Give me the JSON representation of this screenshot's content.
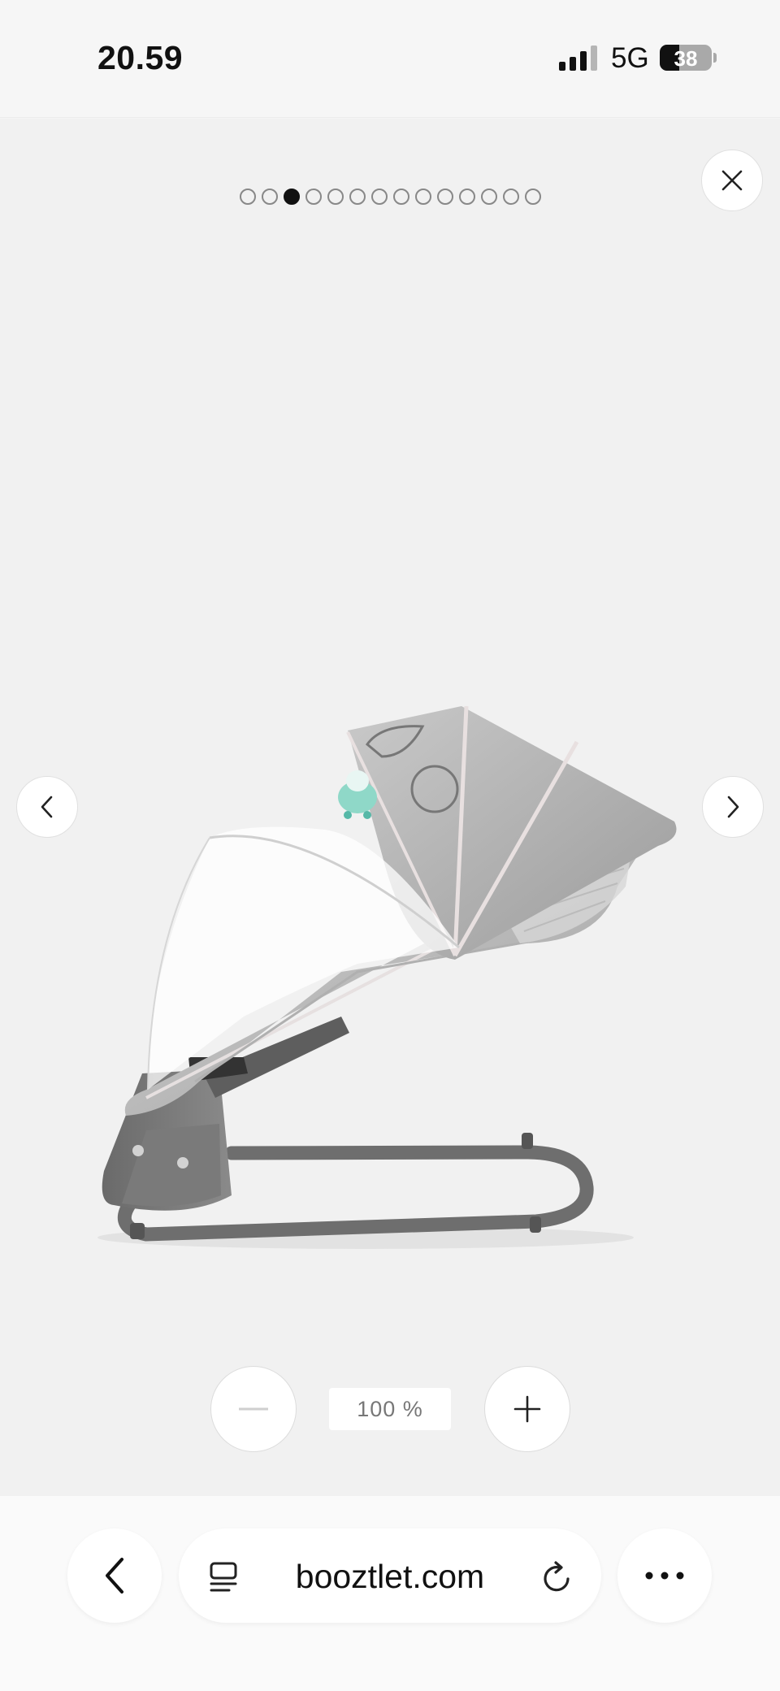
{
  "status_bar": {
    "time": "20.59",
    "network": "5G",
    "battery_level": "38",
    "battery_fraction": 0.38,
    "signal_bars": 4,
    "signal_active": 3
  },
  "gallery": {
    "image_count": 14,
    "active_index": 2,
    "zoom_level": "100 %",
    "product_icon": "baby-bouncer-image"
  },
  "browser": {
    "url": "booztlet.com"
  },
  "colors": {
    "accent": "#111111",
    "page_bg": "#f1f1f1"
  }
}
